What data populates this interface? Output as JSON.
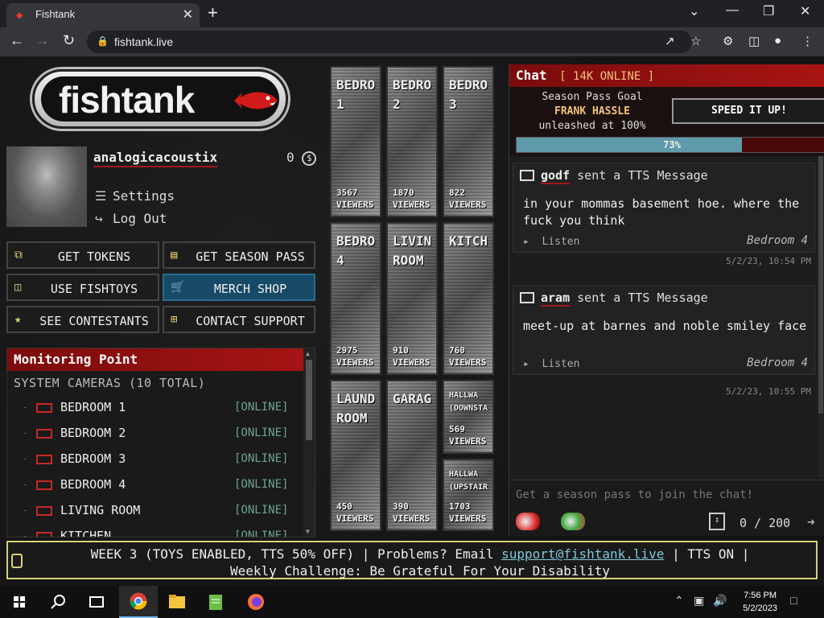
{
  "browser": {
    "tab_title": "Fishtank",
    "url": "fishtank.live"
  },
  "brand": {
    "logo_text": "fishtank"
  },
  "profile": {
    "username": "analogicacoustix",
    "coins": "0",
    "settings_label": "Settings",
    "logout_label": "Log Out"
  },
  "actions": [
    {
      "label": "GET TOKENS",
      "icon": "tokens-icon"
    },
    {
      "label": "GET SEASON PASS",
      "icon": "season-pass-icon"
    },
    {
      "label": "USE FISHTOYS",
      "icon": "gift-icon"
    },
    {
      "label": "MERCH SHOP",
      "icon": "cart-icon"
    },
    {
      "label": "SEE CONTESTANTS",
      "icon": "person-icon"
    },
    {
      "label": "CONTACT SUPPORT",
      "icon": "support-icon"
    }
  ],
  "monitoring": {
    "title": "Monitoring Point",
    "subtitle": "SYSTEM CAMERAS (10 TOTAL)",
    "cameras": [
      {
        "name": "BEDROOM 1",
        "status": "[ONLINE]"
      },
      {
        "name": "BEDROOM 2",
        "status": "[ONLINE]"
      },
      {
        "name": "BEDROOM 3",
        "status": "[ONLINE]"
      },
      {
        "name": "BEDROOM 4",
        "status": "[ONLINE]"
      },
      {
        "name": "LIVING ROOM",
        "status": "[ONLINE]"
      },
      {
        "name": "KITCHEN",
        "status": "[ONLINE]"
      }
    ]
  },
  "feeds": [
    {
      "label": "BEDRO\n1",
      "viewers": "3567",
      "viewers_label": "VIEWERS",
      "status": "ONLINE"
    },
    {
      "label": "BEDRO\n2",
      "viewers": "1870",
      "viewers_label": "VIEWERS",
      "status": "ONLINE"
    },
    {
      "label": "BEDRO\n3",
      "viewers": "822",
      "viewers_label": "VIEWERS",
      "status": "ONLINE"
    },
    {
      "label": "BEDRO\n4",
      "viewers": "2975",
      "viewers_label": "VIEWERS",
      "status": "ONLINE"
    },
    {
      "label": "LIVIN\nROOM",
      "viewers": "910",
      "viewers_label": "VIEWERS",
      "status": "ONLINE"
    },
    {
      "label": "KITCH",
      "viewers": "760",
      "viewers_label": "VIEWERS",
      "status": "ONLINE"
    },
    {
      "label": "LAUND\nROOM",
      "viewers": "450",
      "viewers_label": "VIEWERS",
      "status": "ONLINE"
    },
    {
      "label": "GARAG",
      "viewers": "390",
      "viewers_label": "VIEWERS",
      "status": "ONLINE"
    },
    {
      "label": "HALLWA\n(DOWNSTA",
      "viewers": "569",
      "viewers_label": "VIEWERS",
      "status": "ONLINE"
    },
    {
      "label": "HALLWA\n(UPSTAIR",
      "viewers": "1703",
      "viewers_label": "VIEWERS",
      "status": "ONLINE"
    }
  ],
  "chat": {
    "title": "Chat",
    "online": "[ 14K ONLINE ]",
    "goal_line1": "Season Pass Goal",
    "goal_line2": "FRANK HASSLE",
    "goal_line3": "unleashed at 100%",
    "speed_button": "SPEED IT UP!",
    "progress_value": 0.73,
    "progress_label": "73%",
    "messages": [
      {
        "user": "godf",
        "action": "sent a TTS Message",
        "body": "in your mommas basement hoe. where the fuck you think",
        "listen": "Listen",
        "room": "Bedroom 4",
        "time": "5/2/23, 10:54 PM"
      },
      {
        "user": "aram",
        "action": "sent a TTS Message",
        "body": "meet-up at barnes and noble smiley face",
        "listen": "Listen",
        "room": "Bedroom 4",
        "time": "5/2/23, 10:55 PM"
      }
    ],
    "input_placeholder": "Get a season pass to join the chat!",
    "char_count": "0 / 200"
  },
  "ticker": {
    "text_before": "WEEK 3 (TOYS ENABLED, TTS 50% OFF) | Problems? Email ",
    "email": "support@fishtank.live",
    "text_after": " | TTS ON |",
    "line2": "Weekly Challenge: Be Grateful For Your Disability"
  },
  "taskbar": {
    "time": "7:56 PM",
    "date": "5/2/2023"
  }
}
